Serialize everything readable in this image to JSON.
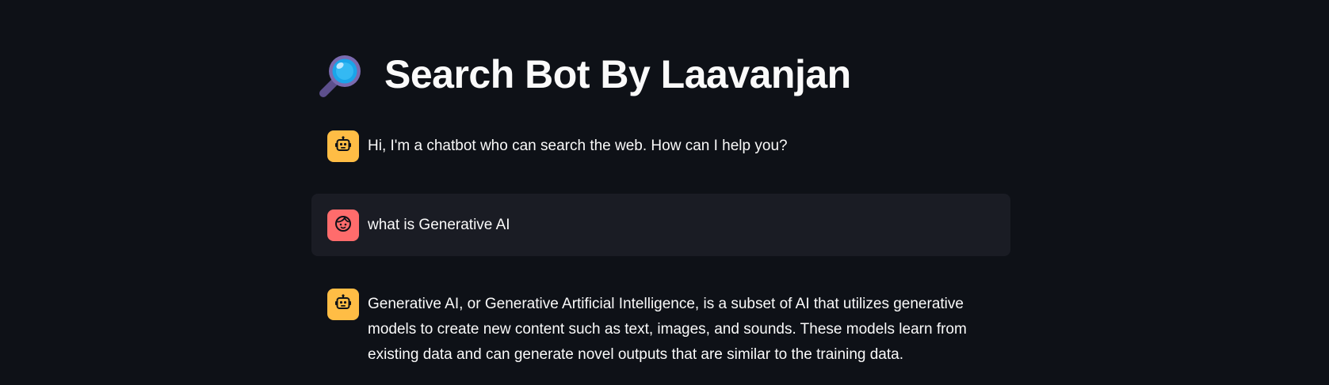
{
  "page": {
    "title": "Search Bot By Laavanjan",
    "title_icon": "magnifying-glass-icon"
  },
  "messages": [
    {
      "role": "assistant",
      "avatar_icon": "robot-icon",
      "text": "Hi, I'm a chatbot who can search the web. How can I help you?"
    },
    {
      "role": "user",
      "avatar_icon": "face-icon",
      "text": "what is Generative AI"
    },
    {
      "role": "assistant",
      "avatar_icon": "robot-icon",
      "text": "Generative AI, or Generative Artificial Intelligence, is a subset of AI that utilizes generative models to create new content such as text, images, and sounds. These models learn from existing data and can generate novel outputs that are similar to the training data."
    }
  ],
  "colors": {
    "background": "#0e1117",
    "user_message_bg": "#1a1c24",
    "assistant_avatar": "#ffbd45",
    "user_avatar": "#ff6c6c",
    "text": "#fafafa"
  }
}
